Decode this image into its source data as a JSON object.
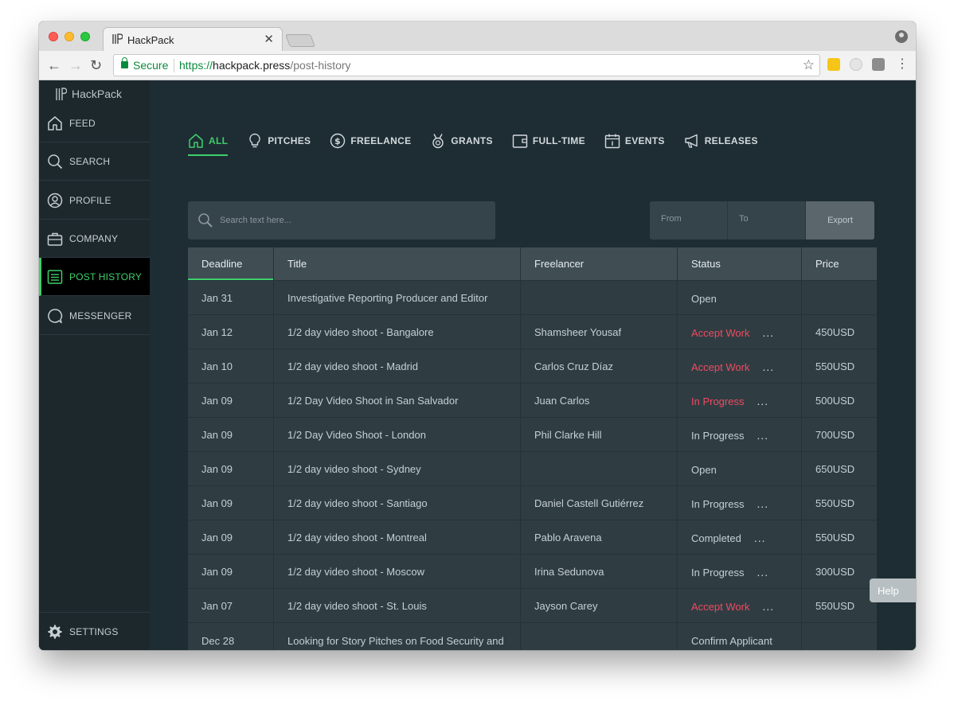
{
  "browser": {
    "tab_title": "HackPack",
    "secure_label": "Secure",
    "url_protocol": "https://",
    "url_host": "hackpack.press",
    "url_path": "/post-history"
  },
  "sidebar": {
    "brand": "HackPack",
    "items": [
      {
        "label": "FEED",
        "icon": "home-icon"
      },
      {
        "label": "SEARCH",
        "icon": "search-icon"
      },
      {
        "label": "PROFILE",
        "icon": "user-icon"
      },
      {
        "label": "COMPANY",
        "icon": "briefcase-icon"
      },
      {
        "label": "POST HISTORY",
        "icon": "list-icon"
      },
      {
        "label": "MESSENGER",
        "icon": "chat-icon"
      }
    ],
    "active": "POST HISTORY",
    "settings_label": "SETTINGS"
  },
  "filters": {
    "items": [
      {
        "label": "ALL",
        "icon": "home-icon"
      },
      {
        "label": "PITCHES",
        "icon": "bulb-icon"
      },
      {
        "label": "FREELANCE",
        "icon": "dollar-icon"
      },
      {
        "label": "GRANTS",
        "icon": "medal-icon"
      },
      {
        "label": "FULL-TIME",
        "icon": "wallet-icon"
      },
      {
        "label": "EVENTS",
        "icon": "calendar-icon"
      },
      {
        "label": "RELEASES",
        "icon": "megaphone-icon"
      }
    ],
    "active": "ALL"
  },
  "search": {
    "placeholder": "Search text here..."
  },
  "date_range": {
    "from_placeholder": "From",
    "to_placeholder": "To",
    "export_label": "Export"
  },
  "table": {
    "headers": [
      "Deadline",
      "Title",
      "Freelancer",
      "Status",
      "Price"
    ],
    "rows": [
      {
        "deadline": "Jan 31",
        "title": "Investigative Reporting Producer and Editor",
        "freelancer": "",
        "status": "Open",
        "price": ""
      },
      {
        "deadline": "Jan 12",
        "title": "1/2 day video shoot - Bangalore",
        "freelancer": "Shamsheer Yousaf",
        "status": "Accept Work",
        "price": "450USD"
      },
      {
        "deadline": "Jan 10",
        "title": "1/2 day video shoot - Madrid",
        "freelancer": "Carlos Cruz Díaz",
        "status": "Accept Work",
        "price": "550USD"
      },
      {
        "deadline": "Jan 09",
        "title": "1/2 Day Video Shoot in San Salvador",
        "freelancer": "Juan Carlos",
        "status": "In Progress",
        "price": "500USD"
      },
      {
        "deadline": "Jan 09",
        "title": "1/2 Day Video Shoot - London",
        "freelancer": "Phil Clarke Hill",
        "status": "In Progress",
        "price": "700USD"
      },
      {
        "deadline": "Jan 09",
        "title": "1/2 day video shoot - Sydney",
        "freelancer": "",
        "status": "Open",
        "price": "650USD"
      },
      {
        "deadline": "Jan 09",
        "title": "1/2 day video shoot - Santiago",
        "freelancer": "Daniel Castell Gutiérrez",
        "status": "In Progress",
        "price": "550USD"
      },
      {
        "deadline": "Jan 09",
        "title": "1/2 day video shoot - Montreal",
        "freelancer": "Pablo Aravena",
        "status": "Completed",
        "price": "550USD"
      },
      {
        "deadline": "Jan 09",
        "title": "1/2 day video shoot - Moscow",
        "freelancer": "Irina Sedunova",
        "status": "In Progress",
        "price": "300USD"
      },
      {
        "deadline": "Jan 07",
        "title": "1/2 day video shoot - St. Louis",
        "freelancer": "Jayson Carey",
        "status": "Accept Work",
        "price": "550USD"
      },
      {
        "deadline": "Dec 28",
        "title": "Looking for Story Pitches on Food Security and freelancers",
        "freelancer": "",
        "status": "Confirm Applicant",
        "price": ""
      }
    ],
    "more_label": "..."
  },
  "help_label": "Help",
  "colors": {
    "accent": "#3ecf6a",
    "alert": "#ef4a5f",
    "background": "#1e2d34",
    "sidebar": "#1d282d"
  }
}
